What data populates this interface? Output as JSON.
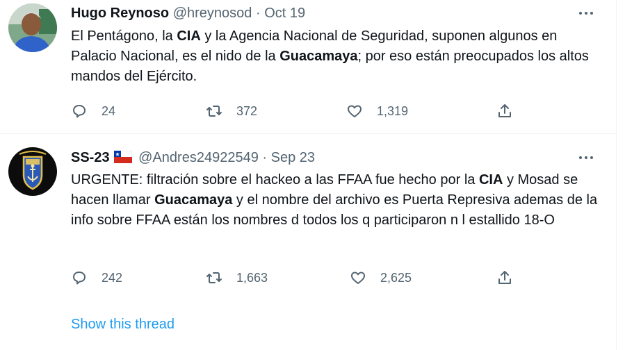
{
  "tweets": [
    {
      "display_name": "Hugo Reynoso",
      "handle": "@hreynosod",
      "separator": "·",
      "date": "Oct 19",
      "text": {
        "p1": "El Pentágono, la ",
        "b1": "CIA",
        "p2": " y la Agencia Nacional de Seguridad, suponen algunos en Palacio Nacional, es el nido de la ",
        "b2": "Guacamaya",
        "p3": "; por eso están preocupados los altos mandos del Ejército."
      },
      "replies": "24",
      "retweets": "372",
      "likes": "1,319"
    },
    {
      "display_name": "SS-23",
      "flag": "chile-flag",
      "handle": "@Andres24922549",
      "separator": "·",
      "date": "Sep 23",
      "text": {
        "p1": "URGENTE: filtración sobre el hackeo a las FFAA fue hecho por la ",
        "b1": "CIA",
        "p2": " y Mosad se hacen llamar ",
        "b2": "Guacamaya",
        "p3": " y el nombre del archivo es Puerta Represiva ademas de la info sobre FFAA están los nombres d todos los q participaron n l estallido 18-O"
      },
      "replies": "242",
      "retweets": "1,663",
      "likes": "2,625"
    }
  ],
  "show_thread_label": "Show this thread",
  "icons": [
    "reply-icon",
    "retweet-icon",
    "like-icon",
    "share-icon",
    "more-icon"
  ],
  "colors": {
    "link": "#1d9bf0",
    "muted": "#536471",
    "text": "#0f1419",
    "divider": "#eff3f4"
  }
}
